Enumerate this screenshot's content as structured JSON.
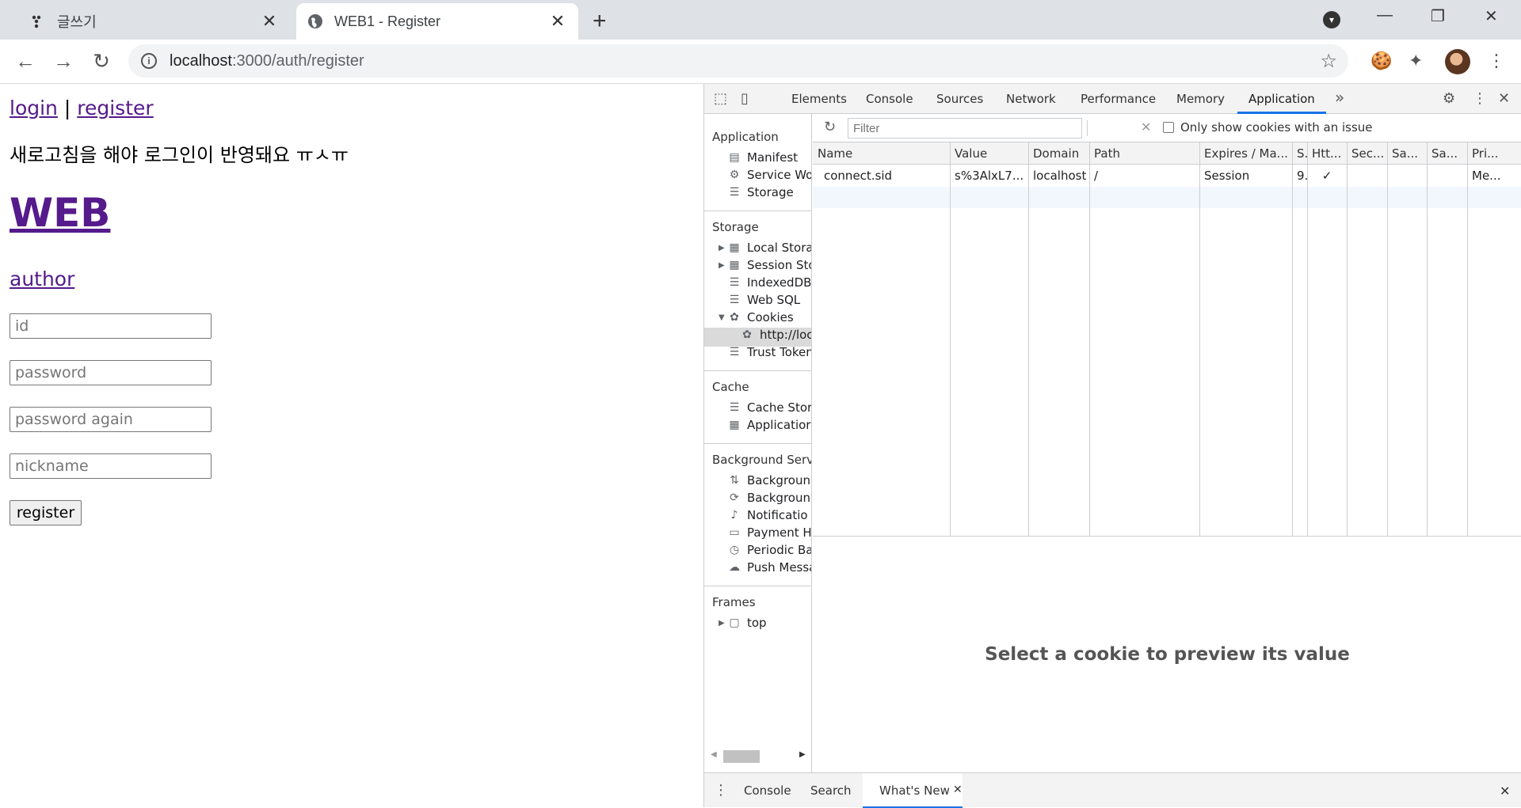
{
  "browser": {
    "tabs": [
      {
        "title": "글쓰기",
        "close": "✕"
      },
      {
        "title": "WEB1 - Register",
        "close": "✕"
      }
    ],
    "new_tab": "+",
    "window_controls": {
      "minimize": "—",
      "restore": "❐",
      "close": "✕"
    },
    "url_host": "localhost",
    "url_path": ":3000/auth/register"
  },
  "page": {
    "login_link": "login",
    "separator": "|",
    "register_link": "register",
    "notice": "새로고침을 해야 로그인이 반영돼요 ㅠㅅㅠ",
    "title": "WEB",
    "author_link": "author",
    "id_placeholder": "id",
    "password_placeholder": "password",
    "password_again_placeholder": "password again",
    "nickname_placeholder": "nickname",
    "register_button": "register"
  },
  "devtools": {
    "tabs": [
      "Elements",
      "Console",
      "Sources",
      "Network",
      "Performance",
      "Memory",
      "Application"
    ],
    "more": "»",
    "sidebar": {
      "application_header": "Application",
      "application_items": [
        "Manifest",
        "Service Wo",
        "Storage"
      ],
      "storage_header": "Storage",
      "storage_items": [
        "Local Stora",
        "Session Sto",
        "IndexedDB",
        "Web SQL",
        "Cookies",
        "http://loc",
        "Trust Token"
      ],
      "cache_header": "Cache",
      "cache_items": [
        "Cache Stor",
        "Applicatior"
      ],
      "background_header": "Background Servi",
      "background_items": [
        "Backgroun",
        "Backgroun",
        "Notificatio",
        "Payment H",
        "Periodic Ba",
        "Push Messa"
      ],
      "frames_header": "Frames",
      "frames_items": [
        "top"
      ]
    },
    "filter_placeholder": "Filter",
    "only_issues_label": "Only show cookies with an issue",
    "columns": [
      "Name",
      "Value",
      "Domain",
      "Path",
      "Expires / Ma...",
      "S.",
      "Htt...",
      "Sec...",
      "Sa...",
      "Sa...",
      "Pri..."
    ],
    "rows": [
      {
        "name": "connect.sid",
        "value": "s%3AlxL7...",
        "domain": "localhost",
        "path": "/",
        "expires": "Session",
        "size": "9.",
        "httponly": "✓",
        "secure": "",
        "samesite": "",
        "sameparty": "",
        "priority": "Me..."
      }
    ],
    "preview_text": "Select a cookie to preview its value",
    "drawer_tabs": [
      "Console",
      "Search",
      "What's New"
    ],
    "drawer_close": "✕"
  }
}
